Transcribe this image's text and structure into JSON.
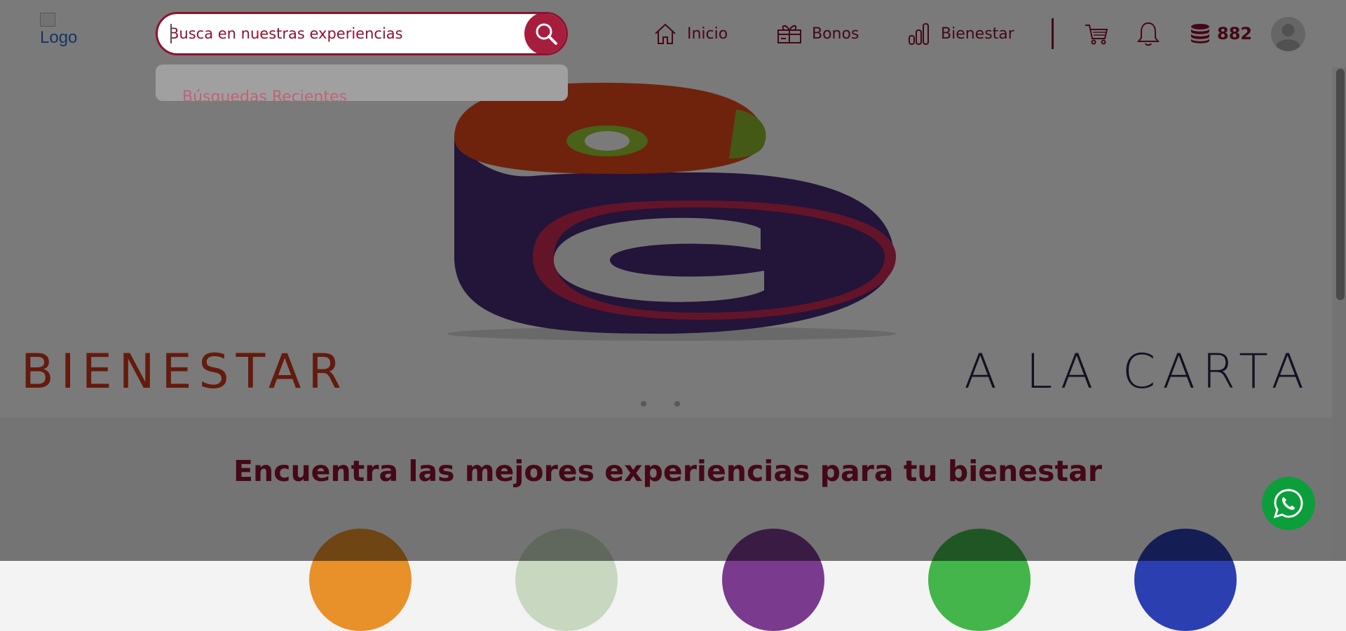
{
  "header": {
    "logo_alt": "Logo",
    "nav": [
      {
        "label": "Inicio",
        "icon": "home-icon"
      },
      {
        "label": "Bonos",
        "icon": "gift-card-icon"
      },
      {
        "label": "Bienestar",
        "icon": "bar-chart-icon"
      }
    ],
    "coins": "882",
    "icons": [
      "cart-icon",
      "bell-icon",
      "coins-icon",
      "avatar-icon"
    ]
  },
  "search": {
    "placeholder": "Busca en nuestras experiencias",
    "value": "",
    "button_icon": "search-icon",
    "dropdown_title": "Búsquedas Recientes"
  },
  "banner": {
    "wordmark_part1": "BIENESTAR",
    "wordmark_part2": "A LA CARTA",
    "slide_dots": 2
  },
  "main": {
    "section_title": "Encuentra las mejores experiencias para tu bienestar",
    "category_colors": [
      "#e8902a",
      "#c8d8c0",
      "#7a3a8e",
      "#43b54a",
      "#2b3fb0"
    ]
  },
  "colors": {
    "brand": "#8e1230",
    "brand_button": "#a71d3e",
    "overlay": "rgba(0,0,0,0.52)",
    "whatsapp": "#0b9e3b"
  },
  "floating": {
    "whatsapp_icon": "whatsapp-icon"
  }
}
